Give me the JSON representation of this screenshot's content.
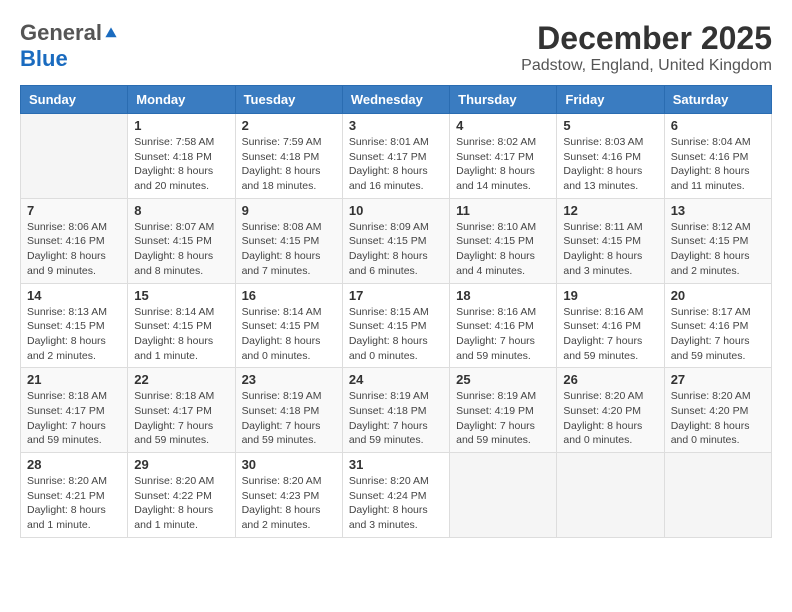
{
  "logo": {
    "general": "General",
    "blue": "Blue"
  },
  "header": {
    "title": "December 2025",
    "location": "Padstow, England, United Kingdom"
  },
  "weekdays": [
    "Sunday",
    "Monday",
    "Tuesday",
    "Wednesday",
    "Thursday",
    "Friday",
    "Saturday"
  ],
  "weeks": [
    [
      {
        "day": "",
        "sunrise": "",
        "sunset": "",
        "daylight": ""
      },
      {
        "day": "1",
        "sunrise": "Sunrise: 7:58 AM",
        "sunset": "Sunset: 4:18 PM",
        "daylight": "Daylight: 8 hours and 20 minutes."
      },
      {
        "day": "2",
        "sunrise": "Sunrise: 7:59 AM",
        "sunset": "Sunset: 4:18 PM",
        "daylight": "Daylight: 8 hours and 18 minutes."
      },
      {
        "day": "3",
        "sunrise": "Sunrise: 8:01 AM",
        "sunset": "Sunset: 4:17 PM",
        "daylight": "Daylight: 8 hours and 16 minutes."
      },
      {
        "day": "4",
        "sunrise": "Sunrise: 8:02 AM",
        "sunset": "Sunset: 4:17 PM",
        "daylight": "Daylight: 8 hours and 14 minutes."
      },
      {
        "day": "5",
        "sunrise": "Sunrise: 8:03 AM",
        "sunset": "Sunset: 4:16 PM",
        "daylight": "Daylight: 8 hours and 13 minutes."
      },
      {
        "day": "6",
        "sunrise": "Sunrise: 8:04 AM",
        "sunset": "Sunset: 4:16 PM",
        "daylight": "Daylight: 8 hours and 11 minutes."
      }
    ],
    [
      {
        "day": "7",
        "sunrise": "Sunrise: 8:06 AM",
        "sunset": "Sunset: 4:16 PM",
        "daylight": "Daylight: 8 hours and 9 minutes."
      },
      {
        "day": "8",
        "sunrise": "Sunrise: 8:07 AM",
        "sunset": "Sunset: 4:15 PM",
        "daylight": "Daylight: 8 hours and 8 minutes."
      },
      {
        "day": "9",
        "sunrise": "Sunrise: 8:08 AM",
        "sunset": "Sunset: 4:15 PM",
        "daylight": "Daylight: 8 hours and 7 minutes."
      },
      {
        "day": "10",
        "sunrise": "Sunrise: 8:09 AM",
        "sunset": "Sunset: 4:15 PM",
        "daylight": "Daylight: 8 hours and 6 minutes."
      },
      {
        "day": "11",
        "sunrise": "Sunrise: 8:10 AM",
        "sunset": "Sunset: 4:15 PM",
        "daylight": "Daylight: 8 hours and 4 minutes."
      },
      {
        "day": "12",
        "sunrise": "Sunrise: 8:11 AM",
        "sunset": "Sunset: 4:15 PM",
        "daylight": "Daylight: 8 hours and 3 minutes."
      },
      {
        "day": "13",
        "sunrise": "Sunrise: 8:12 AM",
        "sunset": "Sunset: 4:15 PM",
        "daylight": "Daylight: 8 hours and 2 minutes."
      }
    ],
    [
      {
        "day": "14",
        "sunrise": "Sunrise: 8:13 AM",
        "sunset": "Sunset: 4:15 PM",
        "daylight": "Daylight: 8 hours and 2 minutes."
      },
      {
        "day": "15",
        "sunrise": "Sunrise: 8:14 AM",
        "sunset": "Sunset: 4:15 PM",
        "daylight": "Daylight: 8 hours and 1 minute."
      },
      {
        "day": "16",
        "sunrise": "Sunrise: 8:14 AM",
        "sunset": "Sunset: 4:15 PM",
        "daylight": "Daylight: 8 hours and 0 minutes."
      },
      {
        "day": "17",
        "sunrise": "Sunrise: 8:15 AM",
        "sunset": "Sunset: 4:15 PM",
        "daylight": "Daylight: 8 hours and 0 minutes."
      },
      {
        "day": "18",
        "sunrise": "Sunrise: 8:16 AM",
        "sunset": "Sunset: 4:16 PM",
        "daylight": "Daylight: 7 hours and 59 minutes."
      },
      {
        "day": "19",
        "sunrise": "Sunrise: 8:16 AM",
        "sunset": "Sunset: 4:16 PM",
        "daylight": "Daylight: 7 hours and 59 minutes."
      },
      {
        "day": "20",
        "sunrise": "Sunrise: 8:17 AM",
        "sunset": "Sunset: 4:16 PM",
        "daylight": "Daylight: 7 hours and 59 minutes."
      }
    ],
    [
      {
        "day": "21",
        "sunrise": "Sunrise: 8:18 AM",
        "sunset": "Sunset: 4:17 PM",
        "daylight": "Daylight: 7 hours and 59 minutes."
      },
      {
        "day": "22",
        "sunrise": "Sunrise: 8:18 AM",
        "sunset": "Sunset: 4:17 PM",
        "daylight": "Daylight: 7 hours and 59 minutes."
      },
      {
        "day": "23",
        "sunrise": "Sunrise: 8:19 AM",
        "sunset": "Sunset: 4:18 PM",
        "daylight": "Daylight: 7 hours and 59 minutes."
      },
      {
        "day": "24",
        "sunrise": "Sunrise: 8:19 AM",
        "sunset": "Sunset: 4:18 PM",
        "daylight": "Daylight: 7 hours and 59 minutes."
      },
      {
        "day": "25",
        "sunrise": "Sunrise: 8:19 AM",
        "sunset": "Sunset: 4:19 PM",
        "daylight": "Daylight: 7 hours and 59 minutes."
      },
      {
        "day": "26",
        "sunrise": "Sunrise: 8:20 AM",
        "sunset": "Sunset: 4:20 PM",
        "daylight": "Daylight: 8 hours and 0 minutes."
      },
      {
        "day": "27",
        "sunrise": "Sunrise: 8:20 AM",
        "sunset": "Sunset: 4:20 PM",
        "daylight": "Daylight: 8 hours and 0 minutes."
      }
    ],
    [
      {
        "day": "28",
        "sunrise": "Sunrise: 8:20 AM",
        "sunset": "Sunset: 4:21 PM",
        "daylight": "Daylight: 8 hours and 1 minute."
      },
      {
        "day": "29",
        "sunrise": "Sunrise: 8:20 AM",
        "sunset": "Sunset: 4:22 PM",
        "daylight": "Daylight: 8 hours and 1 minute."
      },
      {
        "day": "30",
        "sunrise": "Sunrise: 8:20 AM",
        "sunset": "Sunset: 4:23 PM",
        "daylight": "Daylight: 8 hours and 2 minutes."
      },
      {
        "day": "31",
        "sunrise": "Sunrise: 8:20 AM",
        "sunset": "Sunset: 4:24 PM",
        "daylight": "Daylight: 8 hours and 3 minutes."
      },
      {
        "day": "",
        "sunrise": "",
        "sunset": "",
        "daylight": ""
      },
      {
        "day": "",
        "sunrise": "",
        "sunset": "",
        "daylight": ""
      },
      {
        "day": "",
        "sunrise": "",
        "sunset": "",
        "daylight": ""
      }
    ]
  ]
}
